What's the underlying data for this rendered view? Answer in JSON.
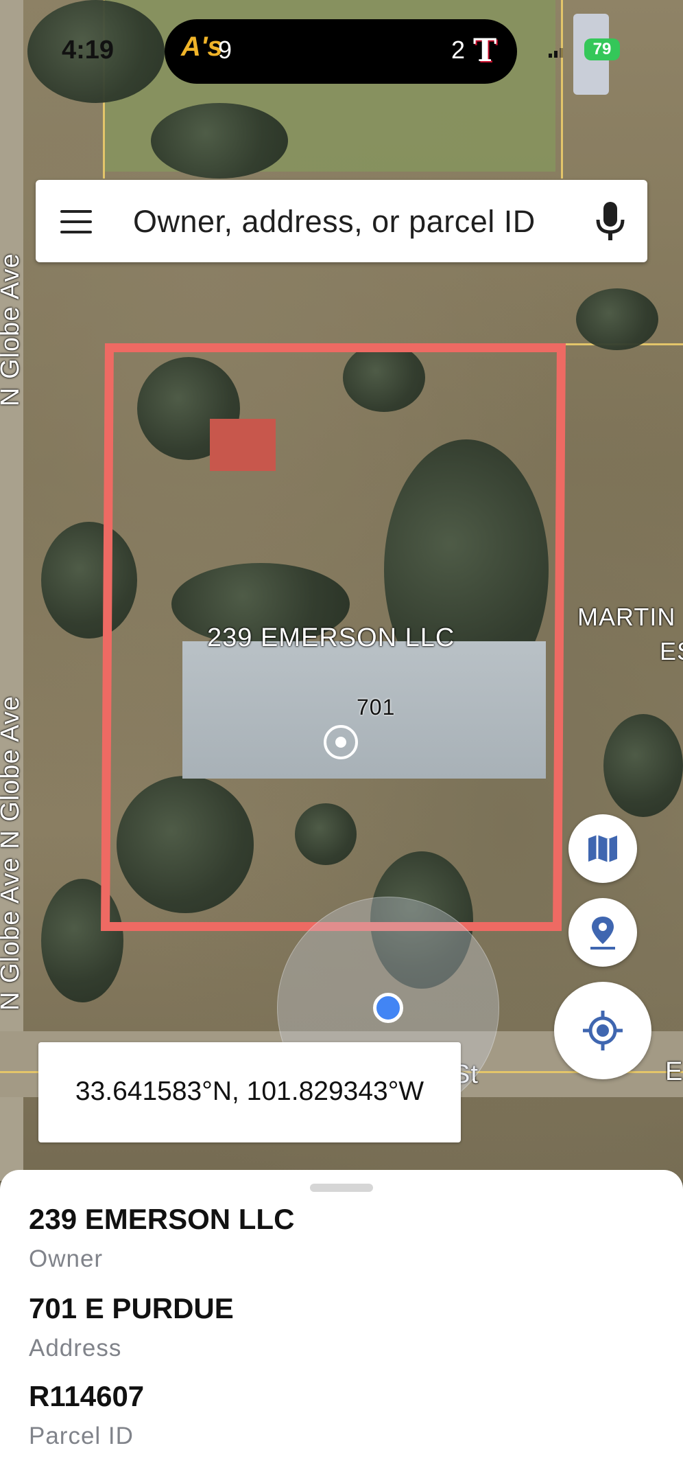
{
  "status_bar": {
    "time": "4:19",
    "live_activity": {
      "team_a": "A's",
      "team_a_score": "9",
      "team_b": "T",
      "team_b_score": "2"
    },
    "battery": "79"
  },
  "search": {
    "placeholder": "Owner, address, or parcel ID",
    "icons": {
      "menu": "menu-icon",
      "mic": "microphone-icon"
    }
  },
  "map": {
    "street_labels": [
      "N Globe Ave",
      "N Globe Ave N Globe Ave",
      "St",
      "E"
    ],
    "parcel_owner_label": "239 EMERSON LLC",
    "parcel_number_label": "701",
    "neighbor_label_line1": "MARTIN",
    "neighbor_label_line2": "ES",
    "outline_color": "#ee6a63",
    "location_dot_color": "#4285f4"
  },
  "controls": {
    "map_type_icon": "map-icon",
    "pin_icon": "pin-icon",
    "my_location_icon": "crosshair-icon",
    "icon_color": "#3f66b0"
  },
  "coordinates": {
    "text": "33.641583°N, 101.829343°W"
  },
  "details": {
    "owner_value": "239 EMERSON LLC",
    "owner_label": "Owner",
    "address_value": "701 E PURDUE",
    "address_label": "Address",
    "parcel_value": "R114607",
    "parcel_label": "Parcel ID"
  }
}
